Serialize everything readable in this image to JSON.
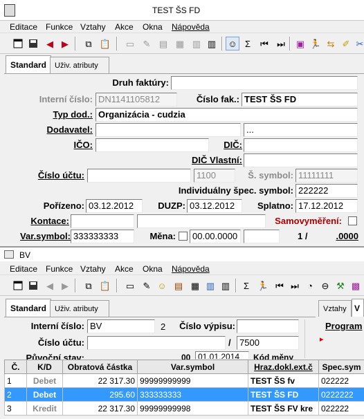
{
  "window1": {
    "title": "TEST ŠS FD",
    "menu": [
      "Editace",
      "Funkce",
      "Vztahy",
      "Akce",
      "Okna",
      "Nápověda"
    ],
    "tabs": [
      "Standard",
      "Uživ. atributy"
    ],
    "labels": {
      "druh_faktury": "Druh faktúry:",
      "interni_cislo": "Interní číslo:",
      "cislo_fak": "Číslo fak.:",
      "typ_dod": "Typ dod.:",
      "dodavatel": "Dodavatel:",
      "ico": "IČO:",
      "dic": "DIČ:",
      "dic_vlastni": "DIČ Vlastní:",
      "cislo_uctu": "Číslo účtu:",
      "s_symbol": "Š. symbol:",
      "individualny": "Individuálny špec. symbol:",
      "porizeno": "Pořízeno:",
      "duzp": "DUZP:",
      "splatno": "Splatno:",
      "kontace": "Kontace:",
      "samovymereni": "Samovyměření:",
      "var_symbol": "Var.symbol:",
      "mena": "Měna:",
      "one_slash": "1 /"
    },
    "values": {
      "druh_faktury": "",
      "interni_cislo": "DN1141105812",
      "cislo_fak": "TEST ŠS FD",
      "typ_dod": "Organizácia - cudzia",
      "dodavatel_1": "",
      "dodavatel_2": "...",
      "ico": "",
      "dic": "",
      "dic_vlastni": "",
      "cislo_uctu": "",
      "bank_code": "1100",
      "s_symbol": "11111111",
      "individualny": "222222",
      "porizeno": "03.12.2012",
      "duzp": "03.12.2012",
      "splatno": "17.12.2012",
      "kontace_1": "",
      "kontace_2": "",
      "var_symbol": "333333333",
      "mena_field": "00.00.0000",
      "mena_extra": "",
      "amount_right": ".0000"
    }
  },
  "window2": {
    "title": "BV",
    "menu": [
      "Editace",
      "Funkce",
      "Vztahy",
      "Akce",
      "Okna",
      "Nápověda"
    ],
    "tabs": [
      "Standard",
      "Uživ. atributy"
    ],
    "right_tabs": [
      "Vztahy",
      "V"
    ],
    "right_link": "Program",
    "labels": {
      "interni_cislo": "Interní číslo:",
      "cislo_vypisu": "Číslo výpisu:",
      "cislo_uctu": "Číslo účtu:",
      "puvodni_stav": "Půvoční stav:"
    },
    "values": {
      "interni_cislo": "BV",
      "interni_cislo_suffix": "2",
      "cislo_vypisu": "",
      "cislo_uctu": "",
      "slash": "/",
      "bank_code": "7500",
      "puvodni_date": "01.01.2014",
      "puvodni_00": "00",
      "kod_meny": "Kód měny"
    },
    "grid": {
      "headers": [
        "Č.",
        "K/D",
        "Obratová částka",
        "Var.symbol",
        "Hraz.dokl.ext.č",
        "Spec.sym"
      ],
      "rows": [
        {
          "c": "1",
          "kd": "Debet",
          "castka": "22 317.30",
          "vs": "99999999999",
          "hraz": "TEST ŠS fv",
          "spec": "022222"
        },
        {
          "c": "2",
          "kd": "Debet",
          "castka": "295.60",
          "vs": "333333333",
          "hraz": "TEST ŠS FD",
          "spec": "0222222"
        },
        {
          "c": "3",
          "kd": "Kredit",
          "castka": "22 317.30",
          "vs": "99999999998",
          "hraz": "TEST ŠS FV kre",
          "spec": "022222"
        }
      ]
    }
  }
}
